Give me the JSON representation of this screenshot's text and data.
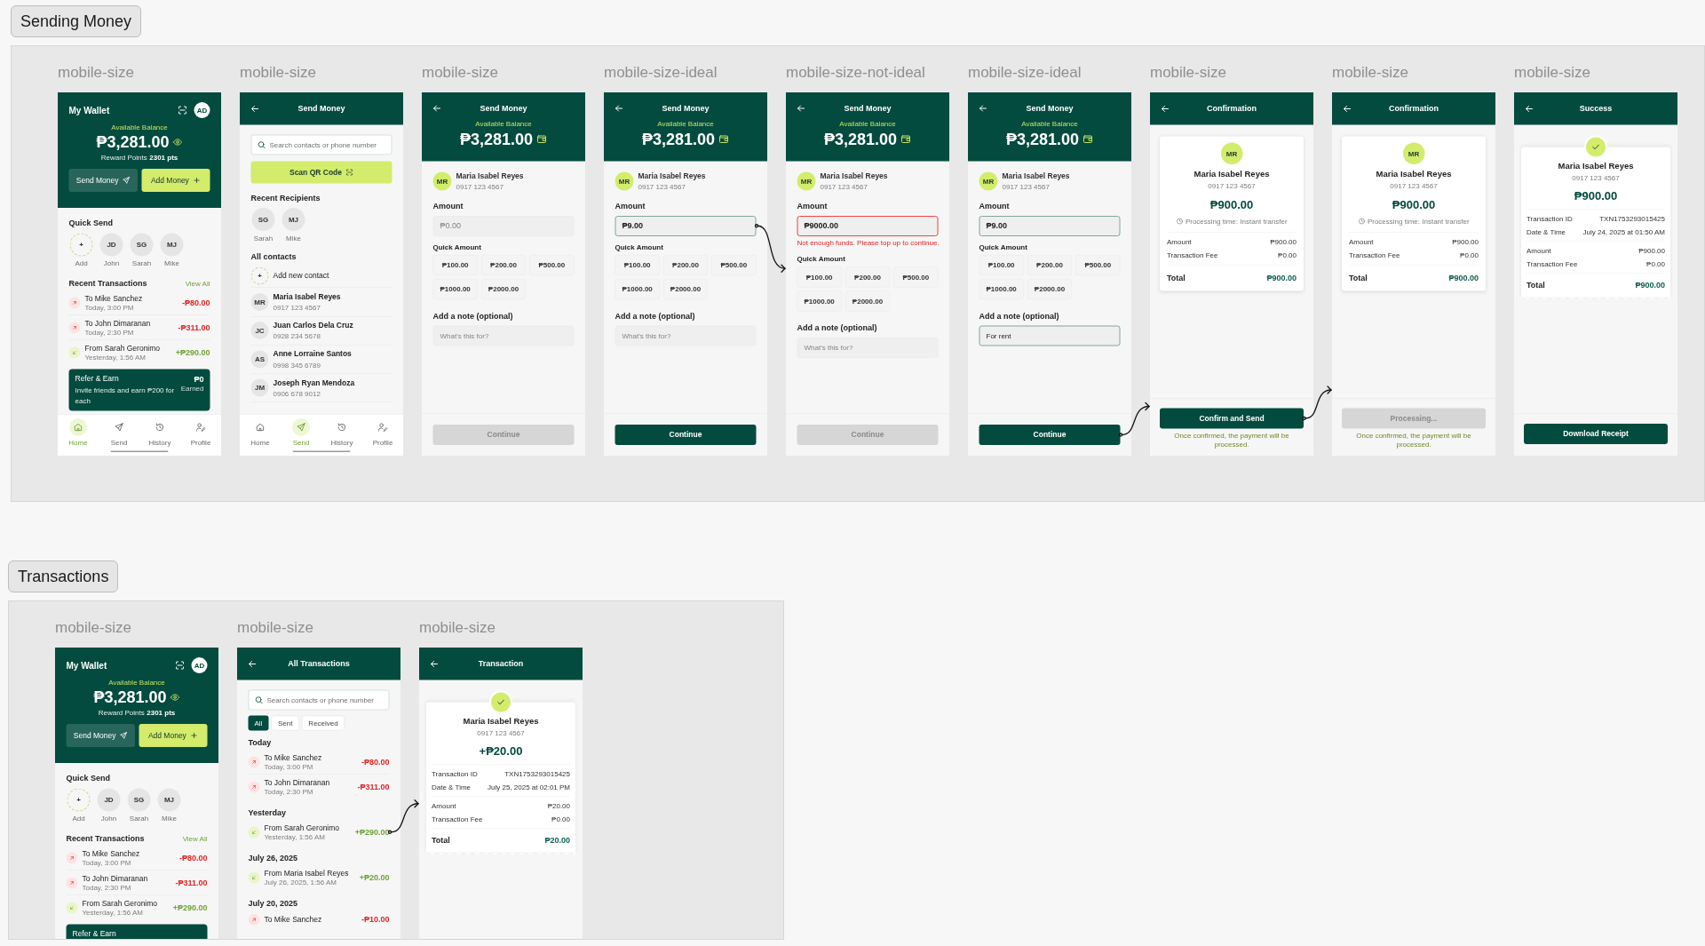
{
  "sections": [
    {
      "title": "Sending Money",
      "frames": [
        {
          "label": "mobile-size",
          "screen": {
            "kind": "wallet",
            "title": "My Wallet",
            "avatar": "AD",
            "balance_label": "Available Balance",
            "balance": "₱3,281.00",
            "reward_label": "Reward Points",
            "reward": "2301 pts",
            "send_button": "Send Money",
            "add_button": "Add Money",
            "quick_title": "Quick Send",
            "quick": [
              {
                "initials": "+",
                "name": "Add",
                "kind": "add"
              },
              {
                "initials": "JD",
                "name": "John",
                "kind": "contact"
              },
              {
                "initials": "SG",
                "name": "Sarah",
                "kind": "contact"
              },
              {
                "initials": "MJ",
                "name": "Mike",
                "kind": "contact"
              }
            ],
            "recent_title": "Recent Transactions",
            "view_all": "View All",
            "transactions": [
              {
                "title": "To Mike Sanchez",
                "time": "Today, 3:00 PM",
                "amount": "-₱80.00",
                "kind": "out"
              },
              {
                "title": "To John Dimaranan",
                "time": "Today, 2:30 PM",
                "amount": "-₱311.00",
                "kind": "out"
              },
              {
                "title": "From Sarah Geronimo",
                "time": "Yesterday, 1:56 AM",
                "amount": "+₱290.00",
                "kind": "in"
              }
            ],
            "promo": {
              "title": "Refer & Earn",
              "text": "Invite friends and earn ₱200 for each",
              "value": "₱0",
              "value_label": "Earned"
            },
            "nav": [
              {
                "label": "Home",
                "kind": "home",
                "selected": true
              },
              {
                "label": "Send",
                "kind": "send",
                "selected": false
              },
              {
                "label": "History",
                "kind": "history",
                "selected": false
              },
              {
                "label": "Profile",
                "kind": "profile",
                "selected": false
              }
            ]
          }
        },
        {
          "label": "mobile-size",
          "screen": {
            "kind": "contacts",
            "title": "Send Money",
            "search": {
              "placeholder": "Search contacts or phone number"
            },
            "scan_button": "Scan QR Code",
            "recent_title": "Recent Recipients",
            "recent": [
              {
                "initials": "SG",
                "name": "Sarah"
              },
              {
                "initials": "MJ",
                "name": "Mike"
              }
            ],
            "contacts_title": "All contacts",
            "add_contact": {
              "icon": "+",
              "label": "Add new contact"
            },
            "contacts": [
              {
                "initials": "MR",
                "name": "Maria Isabel Reyes",
                "phone": "0917 123 4567"
              },
              {
                "initials": "JC",
                "name": "Juan Carlos Dela Cruz",
                "phone": "0928 234 5678"
              },
              {
                "initials": "AS",
                "name": "Anne Lorraine Santos",
                "phone": "0998 345 6789"
              },
              {
                "initials": "JM",
                "name": "Joseph Ryan Mendoza",
                "phone": "0906 678 9012"
              }
            ],
            "nav": [
              {
                "label": "Home",
                "kind": "home",
                "selected": false
              },
              {
                "label": "Send",
                "kind": "send",
                "selected": true
              },
              {
                "label": "History",
                "kind": "history",
                "selected": false
              },
              {
                "label": "Profile",
                "kind": "profile",
                "selected": false
              }
            ]
          }
        },
        {
          "label": "mobile-size",
          "screen": {
            "kind": "amount",
            "title": "Send Money",
            "balance_label": "Available Balance",
            "balance": "₱3,281.00",
            "recipient": {
              "initials": "MR",
              "name": "Maria Isabel Reyes",
              "phone": "0917 123 4567"
            },
            "amount_label": "Amount",
            "amount_field": {
              "placeholder": "₱0.00",
              "focused": false
            },
            "quick_label": "Quick Amount",
            "quick_amounts": [
              "₱100.00",
              "₱200.00",
              "₱500.00",
              "₱1000.00",
              "₱2000.00"
            ],
            "note_label": "Add a note (optional)",
            "note_field": {
              "placeholder": "What's this for?",
              "focused": false
            },
            "button": {
              "label": "Continue",
              "disabled": true
            }
          }
        },
        {
          "label": "mobile-size-ideal",
          "screen": {
            "kind": "amount",
            "title": "Send Money",
            "balance_label": "Available Balance",
            "balance": "₱3,281.00",
            "recipient": {
              "initials": "MR",
              "name": "Maria Isabel Reyes",
              "phone": "0917 123 4567"
            },
            "amount_label": "Amount",
            "amount_field": {
              "value": "₱9.00",
              "focused": true,
              "links_next": true
            },
            "quick_label": "Quick Amount",
            "quick_amounts": [
              "₱100.00",
              "₱200.00",
              "₱500.00",
              "₱1000.00",
              "₱2000.00"
            ],
            "note_label": "Add a note (optional)",
            "note_field": {
              "placeholder": "What's this for?",
              "focused": false
            },
            "button": {
              "label": "Continue",
              "disabled": false
            }
          }
        },
        {
          "label": "mobile-size-not-ideal",
          "screen": {
            "kind": "amount",
            "title": "Send Money",
            "balance_label": "Available Balance",
            "balance": "₱3,281.00",
            "recipient": {
              "initials": "MR",
              "name": "Maria Isabel Reyes",
              "phone": "0917 123 4567"
            },
            "amount_label": "Amount",
            "amount_field": {
              "value": "₱9000.00",
              "error": "Not enough funds. Please top up to continue."
            },
            "quick_label": "Quick Amount",
            "quick_amounts": [
              "₱100.00",
              "₱200.00",
              "₱500.00",
              "₱1000.00",
              "₱2000.00"
            ],
            "note_label": "Add a note (optional)",
            "note_field": {
              "placeholder": "What's this for?",
              "focused": false
            },
            "button": {
              "label": "Continue",
              "disabled": true
            }
          }
        },
        {
          "label": "mobile-size-ideal",
          "screen": {
            "kind": "amount",
            "title": "Send Money",
            "balance_label": "Available Balance",
            "balance": "₱3,281.00",
            "recipient": {
              "initials": "MR",
              "name": "Maria Isabel Reyes",
              "phone": "0917 123 4567"
            },
            "amount_label": "Amount",
            "amount_field": {
              "value": "₱9.00",
              "focused": true
            },
            "quick_label": "Quick Amount",
            "quick_amounts": [
              "₱100.00",
              "₱200.00",
              "₱500.00",
              "₱1000.00",
              "₱2000.00"
            ],
            "note_label": "Add a note (optional)",
            "note_field": {
              "value": "For rent",
              "focused": true
            },
            "button": {
              "label": "Continue",
              "disabled": false,
              "links_next": true
            }
          }
        },
        {
          "label": "mobile-size",
          "screen": {
            "kind": "confirmation",
            "title": "Confirmation",
            "recipient": {
              "initials": "MR",
              "name": "Maria Isabel Reyes",
              "phone": "0917 123 4567"
            },
            "amount": "₱900.00",
            "processing": "Processing time: Instant transfer",
            "rows": [
              {
                "label": "Amount",
                "value": "₱900.00"
              },
              {
                "label": "Transaction Fee",
                "value": "₱0.00"
              }
            ],
            "total": {
              "label": "Total",
              "value": "₱900.00"
            },
            "button": {
              "label": "Confirm and Send",
              "disabled": false,
              "links_next": true
            },
            "footnote": "Once confirmed, the payment will be processed."
          }
        },
        {
          "label": "mobile-size",
          "screen": {
            "kind": "confirmation",
            "title": "Confirmation",
            "recipient": {
              "initials": "MR",
              "name": "Maria Isabel Reyes",
              "phone": "0917 123 4567"
            },
            "amount": "₱900.00",
            "processing": "Processing time: Instant transfer",
            "rows": [
              {
                "label": "Amount",
                "value": "₱900.00"
              },
              {
                "label": "Transaction Fee",
                "value": "₱0.00"
              }
            ],
            "total": {
              "label": "Total",
              "value": "₱900.00"
            },
            "button": {
              "label": "Processing...",
              "disabled": true
            },
            "footnote": "Once confirmed, the payment will be processed."
          }
        },
        {
          "label": "mobile-size",
          "screen": {
            "kind": "receipt",
            "title": "Success",
            "recipient": {
              "name": "Maria Isabel Reyes",
              "phone": "0917 123 4567"
            },
            "amount": "₱900.00",
            "details": [
              {
                "label": "Transaction ID",
                "value": "TXN1753293015425"
              },
              {
                "label": "Date & Time",
                "value": "July 24, 2025 at 01:50 AM"
              }
            ],
            "rows": [
              {
                "label": "Amount",
                "value": "₱900.00"
              },
              {
                "label": "Transaction Fee",
                "value": "₱0.00"
              }
            ],
            "total": {
              "label": "Total",
              "value": "₱900.00"
            },
            "button": {
              "label": "Download Receipt",
              "disabled": false
            }
          }
        }
      ]
    },
    {
      "title": "Transactions",
      "frames": [
        {
          "label": "mobile-size",
          "screen": {
            "kind": "wallet",
            "title": "My Wallet",
            "avatar": "AD",
            "balance_label": "Available Balance",
            "balance": "₱3,281.00",
            "reward_label": "Reward Points",
            "reward": "2301 pts",
            "send_button": "Send Money",
            "add_button": "Add Money",
            "quick_title": "Quick Send",
            "quick": [
              {
                "initials": "+",
                "name": "Add",
                "kind": "add"
              },
              {
                "initials": "JD",
                "name": "John",
                "kind": "contact"
              },
              {
                "initials": "SG",
                "name": "Sarah",
                "kind": "contact"
              },
              {
                "initials": "MJ",
                "name": "Mike",
                "kind": "contact"
              }
            ],
            "recent_title": "Recent Transactions",
            "view_all": "View All",
            "transactions": [
              {
                "title": "To Mike Sanchez",
                "time": "Today, 3:00 PM",
                "amount": "-₱80.00",
                "kind": "out"
              },
              {
                "title": "To John Dimaranan",
                "time": "Today, 2:30 PM",
                "amount": "-₱311.00",
                "kind": "out"
              },
              {
                "title": "From Sarah Geronimo",
                "time": "Yesterday, 1:56 AM",
                "amount": "+₱290.00",
                "kind": "in"
              }
            ],
            "promo": {
              "title": "Refer & Earn"
            }
          }
        },
        {
          "label": "mobile-size",
          "screen": {
            "kind": "history",
            "title": "All Transactions",
            "search": {
              "placeholder": "Search contacts or phone number"
            },
            "filters": [
              {
                "label": "All",
                "selected": true
              },
              {
                "label": "Sent",
                "selected": false
              },
              {
                "label": "Received",
                "selected": false
              }
            ],
            "groups": [
              {
                "title": "Today",
                "transactions": [
                  {
                    "title": "To Mike Sanchez",
                    "time": "Today, 3:00 PM",
                    "amount": "-₱80.00",
                    "kind": "out"
                  },
                  {
                    "title": "To John Dimaranan",
                    "time": "Today, 2:30 PM",
                    "amount": "-₱311.00",
                    "kind": "out"
                  }
                ]
              },
              {
                "title": "Yesterday",
                "transactions": [
                  {
                    "title": "From Sarah Geronimo",
                    "time": "Yesterday, 1:56 AM",
                    "amount": "+₱290.00",
                    "kind": "in",
                    "links_next": true
                  }
                ]
              },
              {
                "title": "July 26, 2025",
                "transactions": [
                  {
                    "title": "From Maria Isabel Reyes",
                    "time": "July 26, 2025, 1:56 AM",
                    "amount": "+₱20.00",
                    "kind": "in"
                  }
                ]
              },
              {
                "title": "July 20, 2025",
                "transactions": [
                  {
                    "title": "To Mike Sanchez",
                    "amount": "-₱10.00",
                    "kind": "out"
                  }
                ]
              }
            ]
          }
        },
        {
          "label": "mobile-size",
          "screen": {
            "kind": "receipt",
            "title": "Transaction",
            "recipient": {
              "name": "Maria Isabel Reyes",
              "phone": "0917 123 4567"
            },
            "amount": "+₱20.00",
            "details": [
              {
                "label": "Transaction ID",
                "value": "TXN1753293015425"
              },
              {
                "label": "Date & Time",
                "value": "July 25, 2025 at 02:01 PM"
              }
            ],
            "rows": [
              {
                "label": "Amount",
                "value": "₱20.00"
              },
              {
                "label": "Transaction Fee",
                "value": "₱0.00"
              }
            ],
            "total": {
              "label": "Total",
              "value": "₱20.00"
            }
          }
        }
      ]
    }
  ]
}
